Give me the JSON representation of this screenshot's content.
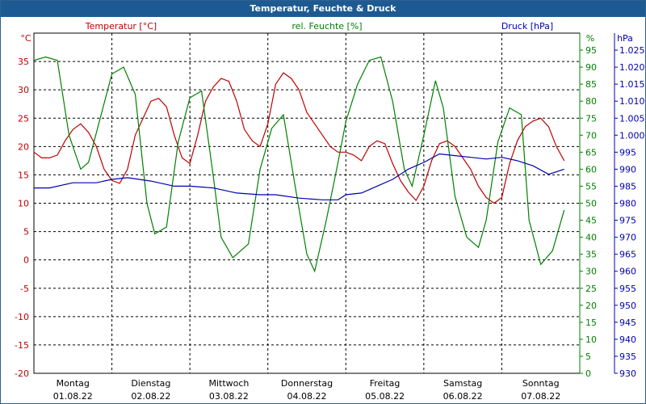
{
  "chart_data": {
    "type": "line",
    "title": "Temperatur, Feuchte & Druck",
    "axes": {
      "temperature": {
        "label": "Temperatur [°C]",
        "unit": "°C",
        "ylim": [
          -20,
          40
        ],
        "ticks": [
          -20,
          -15,
          -10,
          -5,
          0,
          5,
          10,
          15,
          20,
          25,
          30,
          35
        ],
        "color": "#c00000"
      },
      "humidity": {
        "label": "rel. Feuchte [%]",
        "unit": "%",
        "ylim": [
          0,
          100
        ],
        "ticks": [
          0,
          5,
          10,
          15,
          20,
          25,
          30,
          35,
          40,
          45,
          50,
          55,
          60,
          65,
          70,
          75,
          80,
          85,
          90,
          95
        ],
        "color": "#008000"
      },
      "pressure": {
        "label": "Druck [hPa]",
        "unit": "hPa",
        "ylim": [
          930,
          1030
        ],
        "ticks": [
          "930",
          "935",
          "940",
          "945",
          "950",
          "955",
          "960",
          "965",
          "970",
          "975",
          "980",
          "985",
          "990",
          "995",
          "1.000",
          "1.005",
          "1.010",
          "1.015",
          "1.020",
          "1.025"
        ],
        "color": "#0000b0"
      }
    },
    "x_ticks": [
      {
        "day": "Montag",
        "date": "01.08.22"
      },
      {
        "day": "Dienstag",
        "date": "02.08.22"
      },
      {
        "day": "Mittwoch",
        "date": "03.08.22"
      },
      {
        "day": "Donnerstag",
        "date": "04.08.22"
      },
      {
        "day": "Freitag",
        "date": "05.08.22"
      },
      {
        "day": "Samstag",
        "date": "06.08.22"
      },
      {
        "day": "Sonntag",
        "date": "07.08.22"
      }
    ],
    "grid": true,
    "series": [
      {
        "name": "Temperatur [°C]",
        "axis": "temperature",
        "color": "#c00000",
        "x": [
          0,
          0.1,
          0.2,
          0.3,
          0.4,
          0.5,
          0.6,
          0.7,
          0.8,
          0.9,
          1.0,
          1.1,
          1.2,
          1.3,
          1.4,
          1.5,
          1.6,
          1.7,
          1.8,
          1.9,
          2.0,
          2.1,
          2.2,
          2.3,
          2.4,
          2.5,
          2.6,
          2.7,
          2.8,
          2.9,
          3.0,
          3.1,
          3.2,
          3.3,
          3.4,
          3.5,
          3.6,
          3.7,
          3.8,
          3.9,
          4.0,
          4.1,
          4.2,
          4.3,
          4.4,
          4.5,
          4.6,
          4.7,
          4.8,
          4.9,
          5.0,
          5.1,
          5.2,
          5.3,
          5.4,
          5.5,
          5.6,
          5.7,
          5.8,
          5.9,
          6.0,
          6.1,
          6.2,
          6.3,
          6.4,
          6.5,
          6.6,
          6.7,
          6.8
        ],
        "values": [
          19,
          18,
          18,
          18.5,
          21,
          23,
          24,
          22.5,
          20,
          16,
          14,
          13.5,
          16,
          22,
          25,
          28,
          28.5,
          27,
          22,
          18,
          17,
          22,
          28,
          30.5,
          32,
          31.5,
          28,
          23,
          21,
          20,
          24,
          31,
          33,
          32,
          30,
          26,
          24,
          22,
          20,
          19,
          19,
          18.5,
          17.5,
          20,
          21,
          20.5,
          17,
          14,
          12,
          10.5,
          13,
          17.5,
          20.5,
          21,
          20,
          18,
          16,
          13,
          11,
          10,
          11,
          17,
          21,
          23.5,
          24.5,
          25,
          23.5,
          20,
          17.5
        ]
      },
      {
        "name": "rel. Feuchte [%]",
        "axis": "humidity",
        "color": "#008000",
        "x": [
          0,
          0.15,
          0.3,
          0.45,
          0.6,
          0.7,
          0.85,
          1.0,
          1.15,
          1.3,
          1.45,
          1.55,
          1.7,
          1.85,
          2.0,
          2.15,
          2.3,
          2.4,
          2.55,
          2.75,
          2.9,
          3.05,
          3.2,
          3.35,
          3.5,
          3.6,
          3.75,
          3.9,
          4.0,
          4.15,
          4.3,
          4.45,
          4.6,
          4.75,
          4.85,
          5.0,
          5.15,
          5.25,
          5.4,
          5.55,
          5.7,
          5.8,
          5.95,
          6.1,
          6.25,
          6.35,
          6.5,
          6.65,
          6.8
        ],
        "values": [
          92,
          93,
          92,
          70,
          60,
          62,
          75,
          88,
          90,
          82,
          50,
          41,
          43,
          68,
          81,
          83,
          58,
          40,
          34,
          38,
          60,
          72,
          76,
          55,
          35,
          30,
          45,
          62,
          74,
          85,
          92,
          93,
          80,
          60,
          55,
          70,
          86,
          78,
          52,
          40,
          37,
          45,
          68,
          78,
          76,
          45,
          32,
          36,
          48
        ]
      },
      {
        "name": "Druck [hPa]",
        "axis": "pressure",
        "color": "#0000b0",
        "x": [
          0,
          0.2,
          0.5,
          0.8,
          1.0,
          1.2,
          1.5,
          1.8,
          2.0,
          2.3,
          2.6,
          2.9,
          3.1,
          3.4,
          3.7,
          3.9,
          4.0,
          4.2,
          4.4,
          4.6,
          4.8,
          5.0,
          5.2,
          5.4,
          5.6,
          5.8,
          6.0,
          6.2,
          6.4,
          6.6,
          6.8
        ],
        "values": [
          984.5,
          984.5,
          986,
          986,
          987,
          987.5,
          986.5,
          985,
          985,
          984.5,
          983,
          982.5,
          982.5,
          981.5,
          981,
          981,
          982.5,
          983,
          985,
          987,
          990,
          992,
          994.5,
          994,
          993.5,
          993,
          993.5,
          992.5,
          991,
          988.5,
          990
        ]
      }
    ]
  }
}
